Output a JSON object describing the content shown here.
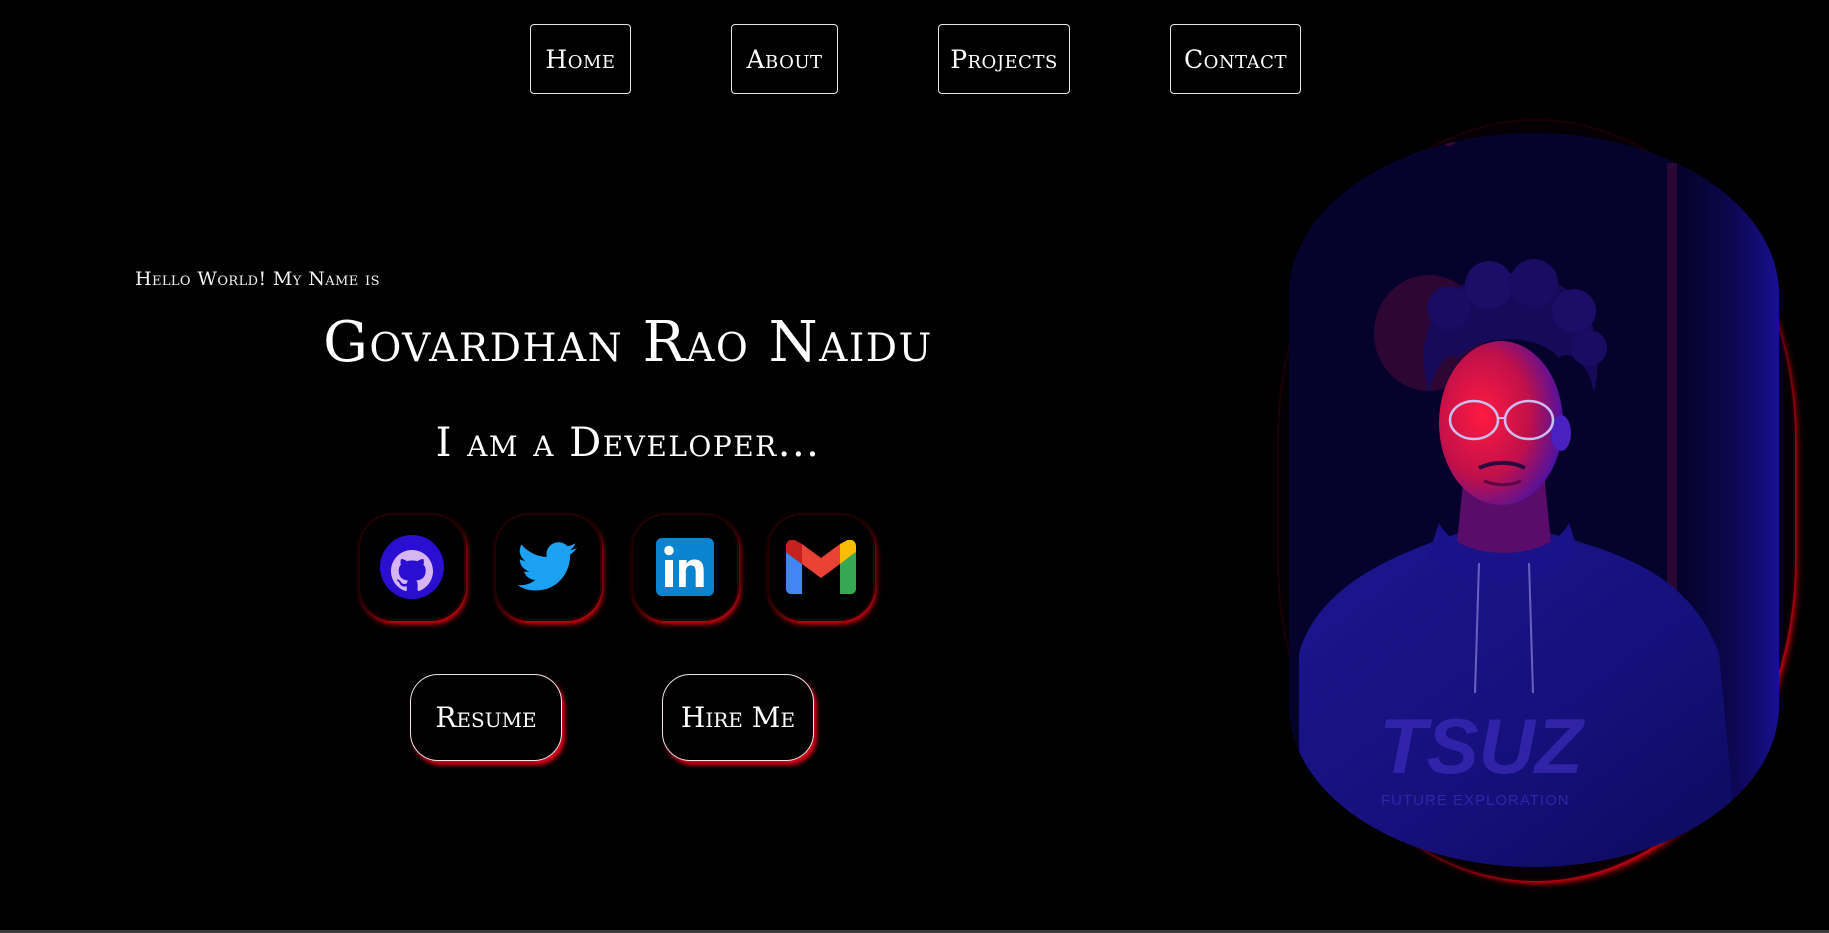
{
  "nav": {
    "items": [
      {
        "label": "Home"
      },
      {
        "label": "About"
      },
      {
        "label": "Projects"
      },
      {
        "label": "Contact"
      }
    ]
  },
  "hero": {
    "greeting": "Hello World! My Name is",
    "name": "Govardhan Rao Naidu",
    "role": "I am a Developer..."
  },
  "social": [
    {
      "icon": "github-icon"
    },
    {
      "icon": "twitter-icon"
    },
    {
      "icon": "linkedin-icon"
    },
    {
      "icon": "gmail-icon"
    }
  ],
  "buttons": {
    "resume_label": "Resume",
    "hire_label": "Hire Me"
  },
  "photo": {
    "shirt_text": "TSUZ",
    "shirt_subtext": "FUTURE EXPLORATION"
  },
  "colors": {
    "background": "#000000",
    "accent_red": "#e00010",
    "photo_blue": "#1a14c8",
    "photo_red": "#ff0a3c"
  }
}
